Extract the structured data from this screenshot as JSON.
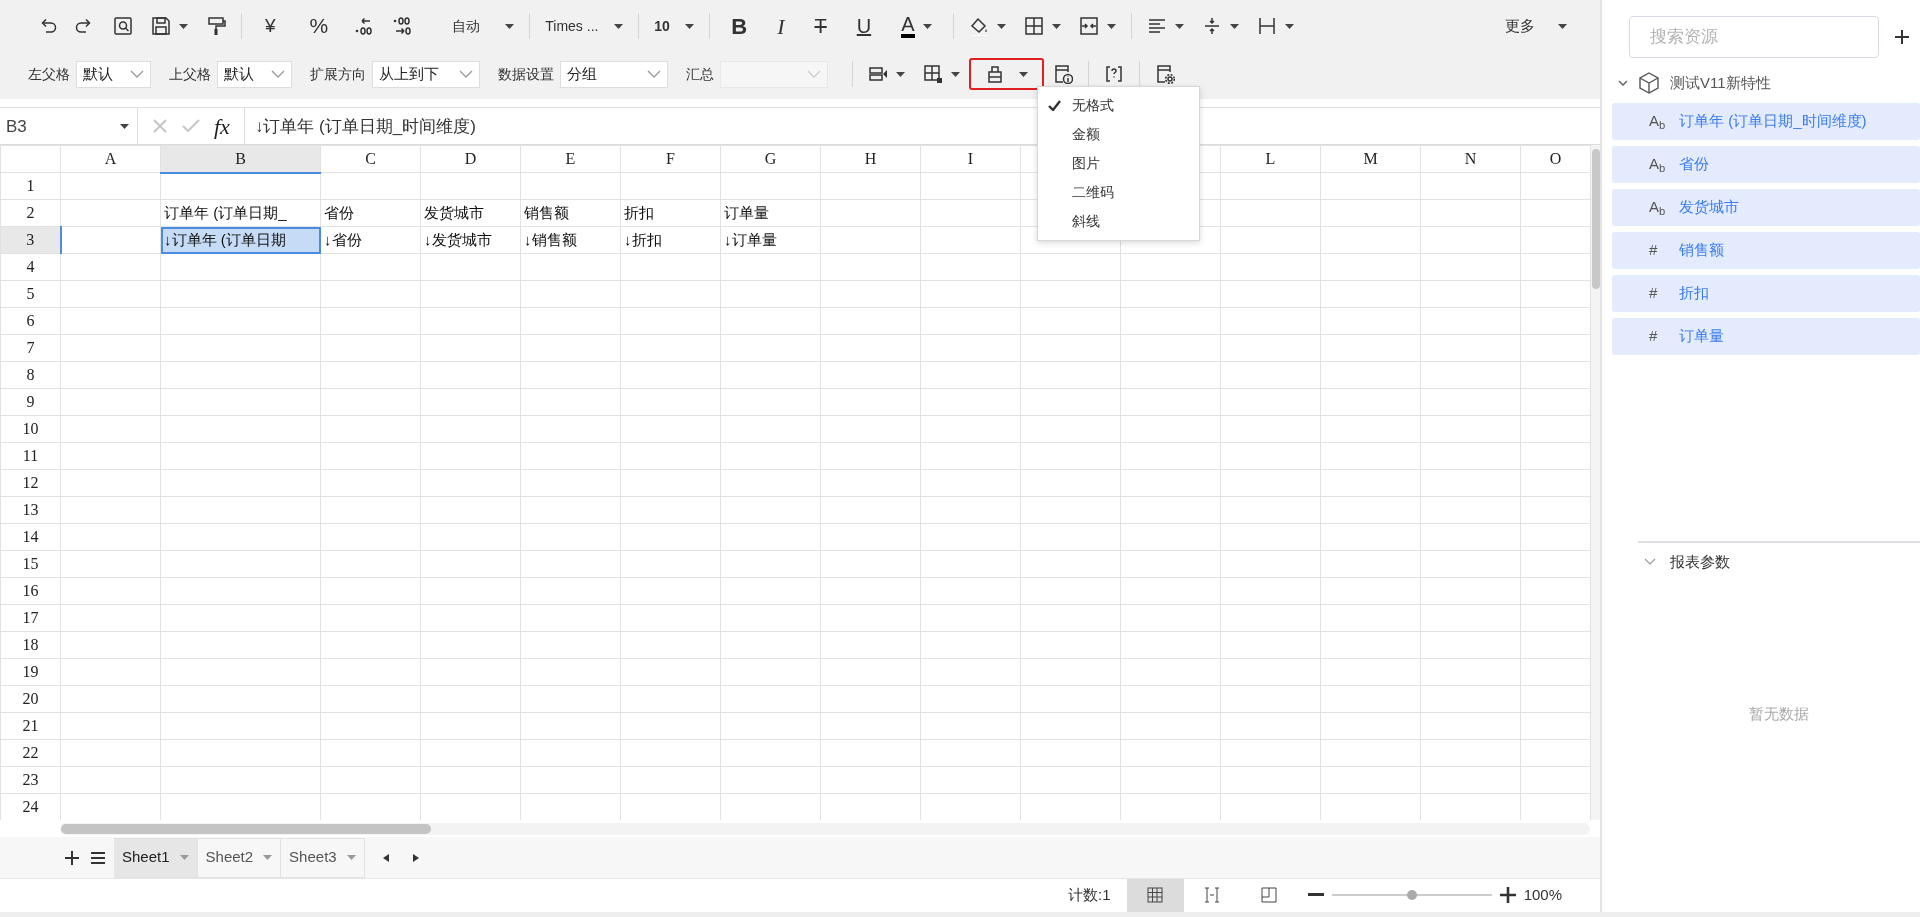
{
  "toolbar": {
    "currency_symbol": "¥",
    "percent_symbol": "%",
    "number_format": "自动",
    "font_family": "Times ...",
    "font_size": "10",
    "text_styles": [
      {
        "kind": "bold",
        "label": "B"
      },
      {
        "kind": "italic",
        "label": "I"
      },
      {
        "kind": "strike",
        "label": "T"
      },
      {
        "kind": "underline",
        "label": "U"
      },
      {
        "kind": "color",
        "label": "A",
        "color": "#000000"
      }
    ],
    "more": "更多",
    "cell_settings": [
      {
        "label": "左父格",
        "value": "默认",
        "disabled": false
      },
      {
        "label": "上父格",
        "value": "默认",
        "disabled": false
      },
      {
        "label": "扩展方向",
        "value": "从上到下",
        "disabled": false
      },
      {
        "label": "数据设置",
        "value": "分组",
        "disabled": false
      },
      {
        "label": "汇总",
        "disabled": true
      }
    ],
    "format_button": {
      "open": true
    },
    "format_menu": [
      {
        "label": "无格式",
        "selected": true
      },
      {
        "label": "金额",
        "selected": false
      },
      {
        "label": "图片",
        "selected": false
      },
      {
        "label": "二维码",
        "selected": false
      },
      {
        "label": "斜线",
        "selected": false
      }
    ]
  },
  "formula_bar": {
    "cell_ref": "B3",
    "fx": "fx",
    "formula": "↓订单年 (订单日期_时间维度)"
  },
  "grid": {
    "columns": [
      {
        "label": "A",
        "selected": false
      },
      {
        "label": "B",
        "selected": true
      },
      {
        "label": "C",
        "selected": false
      },
      {
        "label": "D",
        "selected": false
      },
      {
        "label": "E",
        "selected": false
      },
      {
        "label": "F",
        "selected": false
      },
      {
        "label": "G",
        "selected": false
      },
      {
        "label": "H",
        "selected": false
      },
      {
        "label": "I",
        "selected": false
      },
      null,
      null,
      {
        "label": "L",
        "selected": false
      },
      {
        "label": "M",
        "selected": false
      },
      {
        "label": "N",
        "selected": false
      },
      {
        "label": "O",
        "selected": false
      }
    ],
    "rows": [
      {
        "label": "1",
        "selected": false
      },
      {
        "label": "2",
        "selected": false,
        "cells": [
          null,
          {
            "text": "订单年 (订单日期_",
            "selected": false
          },
          {
            "text": "省份",
            "selected": false
          },
          {
            "text": "发货城市",
            "selected": false
          },
          {
            "text": "销售额",
            "selected": false
          },
          {
            "text": "折扣",
            "selected": false
          },
          {
            "text": "订单量",
            "selected": false
          }
        ]
      },
      {
        "label": "3",
        "selected": true,
        "cells": [
          null,
          {
            "text": "↓订单年 (订单日期",
            "selected": true
          },
          {
            "text": "↓省份",
            "selected": false
          },
          {
            "text": "↓发货城市",
            "selected": false
          },
          {
            "text": "↓销售额",
            "selected": false
          },
          {
            "text": "↓折扣",
            "selected": false
          },
          {
            "text": "↓订单量",
            "selected": false
          }
        ]
      },
      {
        "label": "4",
        "selected": false
      },
      {
        "label": "5",
        "selected": false
      },
      {
        "label": "6",
        "selected": false
      },
      {
        "label": "7",
        "selected": false
      },
      {
        "label": "8",
        "selected": false
      },
      {
        "label": "9",
        "selected": false
      },
      {
        "label": "10",
        "selected": false
      },
      {
        "label": "11",
        "selected": false
      },
      {
        "label": "12",
        "selected": false
      },
      {
        "label": "13",
        "selected": false
      },
      {
        "label": "14",
        "selected": false
      },
      {
        "label": "15",
        "selected": false
      },
      {
        "label": "16",
        "selected": false
      },
      {
        "label": "17",
        "selected": false
      },
      {
        "label": "18",
        "selected": false
      },
      {
        "label": "19",
        "selected": false
      },
      {
        "label": "20",
        "selected": false
      },
      {
        "label": "21",
        "selected": false
      },
      {
        "label": "22",
        "selected": false
      },
      {
        "label": "23",
        "selected": false
      },
      {
        "label": "24",
        "selected": false
      }
    ]
  },
  "sheet_tabs": [
    {
      "label": "Sheet1",
      "selected": true
    },
    {
      "label": "Sheet2",
      "selected": false
    },
    {
      "label": "Sheet3",
      "selected": false
    }
  ],
  "status_bar": {
    "count": "计数:1",
    "views": [
      {
        "kind": "normal",
        "selected": true
      },
      {
        "kind": "page_break",
        "selected": false
      },
      {
        "kind": "page_layout",
        "selected": false
      }
    ],
    "zoom": {
      "level": 0.5,
      "reading": "100%"
    }
  },
  "resources": {
    "search": {
      "placeholder": "搜索资源"
    },
    "tree": {
      "label": "测试V11新特性",
      "expanded": true,
      "children": [
        {
          "badge": "A$_{b}$",
          "label": "订单年 (订单日期_时间维度)"
        },
        {
          "badge": "A$_{b}$",
          "label": "省份"
        },
        {
          "badge": "A$_{b}$",
          "label": "发货城市"
        },
        {
          "badge": "#",
          "label": "销售额"
        },
        {
          "badge": "#",
          "label": "折扣"
        },
        {
          "badge": "#",
          "label": "订单量"
        }
      ]
    },
    "parameters": {
      "title": "报表参数",
      "expanded": true,
      "empty_text": "暂无数据"
    }
  }
}
